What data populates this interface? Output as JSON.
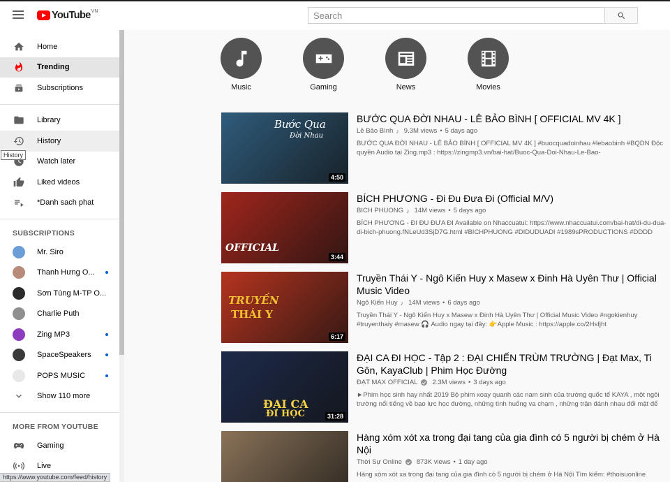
{
  "header": {
    "logo_text": "YouTube",
    "logo_region": "VN",
    "search_placeholder": "Search"
  },
  "sidebar": {
    "primary": [
      {
        "label": "Home",
        "icon": "home-icon"
      },
      {
        "label": "Trending",
        "icon": "trending-flame-icon",
        "active": true
      },
      {
        "label": "Subscriptions",
        "icon": "subscriptions-icon"
      }
    ],
    "library": [
      {
        "label": "Library",
        "icon": "folder-icon"
      },
      {
        "label": "History",
        "icon": "history-icon",
        "hover": true
      },
      {
        "label": "Watch later",
        "icon": "clock-icon"
      },
      {
        "label": "Liked videos",
        "icon": "thumbs-up-icon"
      },
      {
        "label": "*Danh sach phat",
        "icon": "playlist-icon"
      }
    ],
    "subscriptions_heading": "SUBSCRIPTIONS",
    "subscriptions": [
      {
        "label": "Mr. Siro",
        "new": false,
        "color": "#6b9ed6"
      },
      {
        "label": "Thanh Hưng O...",
        "new": true,
        "color": "#b88a7a"
      },
      {
        "label": "Sơn Tùng M-TP O...",
        "new": false,
        "color": "#2b2b2b"
      },
      {
        "label": "Charlie Puth",
        "new": false,
        "color": "#8f8f8f"
      },
      {
        "label": "Zing MP3",
        "new": true,
        "color": "#8e3dbf"
      },
      {
        "label": "SpaceSpeakers",
        "new": true,
        "color": "#3a3a3a"
      },
      {
        "label": "POPS MUSIC",
        "new": true,
        "color": "#e8e8e8"
      }
    ],
    "show_more": "Show 110 more",
    "more_heading": "MORE FROM YOUTUBE",
    "more": [
      {
        "label": "Gaming",
        "icon": "gaming-icon"
      },
      {
        "label": "Live",
        "icon": "live-icon"
      }
    ]
  },
  "tooltip": "History",
  "status_url": "https://www.youtube.com/feed/history",
  "categories": [
    {
      "label": "Music",
      "icon": "music-note-icon"
    },
    {
      "label": "Gaming",
      "icon": "gamepad-icon"
    },
    {
      "label": "News",
      "icon": "newspaper-icon"
    },
    {
      "label": "Movies",
      "icon": "film-icon"
    }
  ],
  "videos": [
    {
      "title": "BƯỚC QUA ĐỜI NHAU - LÊ BẢO BÌNH [ OFFICIAL MV 4K ]",
      "channel": "Lê Bảo Bình",
      "badge": "note",
      "views": "9.3M views",
      "age": "5 days ago",
      "desc": "BƯỚC QUA ĐỜI NHAU - LÊ BẢO BÌNH [ OFFICIAL MV 4K ] #buocquadoinhau #lebaobinh #BQDN Độc quyền Audio tại Zing.mp3 : https://zingmp3.vn/bai-hat/Buoc-Qua-Doi-Nhau-Le-Bao-",
      "duration": "4:50",
      "thumb_text": "Bước Qua",
      "thumb_text2": "Đời Nhau",
      "thumb_color": "#2f5c7c"
    },
    {
      "title": "BÍCH PHƯƠNG - Đi Đu Đưa Đi (Official M/V)",
      "channel": "BICH PHUONG",
      "badge": "note",
      "views": "14M views",
      "age": "5 days ago",
      "desc": "BÍCH PHƯƠNG - ĐI ĐU ĐƯA ĐI Available on Nhaccuatui: https://www.nhaccuatui.com/bai-hat/di-du-dua-di-bich-phuong.fNLeUd3SjD7G.html #BICHPHUONG #DIDUDUADI #1989sPRODUCTIONS #DDDD",
      "duration": "3:44",
      "thumb_text": "OFFICIAL",
      "thumb_color": "#a0261c"
    },
    {
      "title": "Truyền Thái Y - Ngô Kiến Huy x Masew x Đinh Hà Uyên Thư | Official Music Video",
      "channel": "Ngô Kiến Huy",
      "badge": "note",
      "views": "14M views",
      "age": "6 days ago",
      "desc": "Truyền Thái Y - Ngô Kiến Huy x Masew x Đinh Hà Uyên Thư | Official Music Video #ngokienhuy #truyenthaiy #masew 🎧 Audio ngay tại đây: 👉Apple Music : https://apple.co/2Hsfjht",
      "duration": "6:17",
      "thumb_text": "TRUYỀN",
      "thumb_text2": "THÁI Y",
      "thumb_color": "#b5341f"
    },
    {
      "title": "ĐẠI CA ĐI HỌC - Tập 2 : ĐẠI CHIẾN TRÙM TRƯỜNG | Đạt Max, Ti Gôn, KayaClub | Phim Học Đường",
      "channel": "ĐẠT MAX OFFICIAL",
      "badge": "check",
      "views": "2.3M views",
      "age": "3 days ago",
      "desc": "►Phim học sinh hay nhất 2019 Bộ phim xoay quanh các nam sinh của trường quốc tế KAYA , một ngôi trường nổi tiếng về bạo lực học đường, những tình huống va chạm , những trận đánh nhau đối mặt để",
      "duration": "31:28",
      "thumb_text": "ĐẠI CA",
      "thumb_text2": "ĐI HỌC",
      "thumb_color": "#1d2a4a"
    },
    {
      "title": "Hàng xóm xót xa trong đại tang của gia đình có 5 người bị chém ở Hà Nội",
      "channel": "Thời Sự Online",
      "badge": "check",
      "views": "873K views",
      "age": "1 day ago",
      "desc": "Hàng xóm xót xa trong đại tang của gia đình có 5 người bị chém ở Hà Nội Tìm kiếm: #thoisuonline",
      "duration": "",
      "thumb_color": "#8a7258"
    }
  ]
}
